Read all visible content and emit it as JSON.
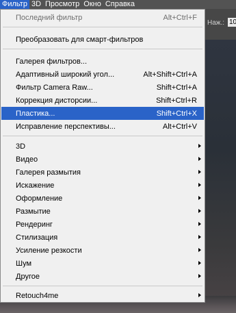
{
  "menubar": {
    "items": [
      "Фильтр",
      "3D",
      "Просмотр",
      "Окно",
      "Справка"
    ]
  },
  "toolbar": {
    "pressure_label": "Наж.:",
    "pressure_value": "10"
  },
  "menu": {
    "last_filter": {
      "label": "Последний фильтр",
      "shortcut": "Alt+Ctrl+F"
    },
    "convert_smart": {
      "label": "Преобразовать для смарт-фильтров"
    },
    "filter_gallery": {
      "label": "Галерея фильтров..."
    },
    "adaptive_wide_angle": {
      "label": "Адаптивный широкий угол...",
      "shortcut": "Alt+Shift+Ctrl+A"
    },
    "camera_raw": {
      "label": "Фильтр Camera Raw...",
      "shortcut": "Shift+Ctrl+A"
    },
    "lens_correction": {
      "label": "Коррекция дисторсии...",
      "shortcut": "Shift+Ctrl+R"
    },
    "liquify": {
      "label": "Пластика...",
      "shortcut": "Shift+Ctrl+X"
    },
    "vanishing_point": {
      "label": "Исправление перспективы...",
      "shortcut": "Alt+Ctrl+V"
    },
    "submenus": [
      "3D",
      "Видео",
      "Галерея размытия",
      "Искажение",
      "Оформление",
      "Размытие",
      "Рендеринг",
      "Стилизация",
      "Усиление резкости",
      "Шум",
      "Другое"
    ],
    "plugin": {
      "label": "Retouch4me"
    }
  },
  "colors": {
    "highlight": "#2a63c8",
    "menu_bg": "#f0f0f0",
    "menubar_bg": "#535353"
  }
}
